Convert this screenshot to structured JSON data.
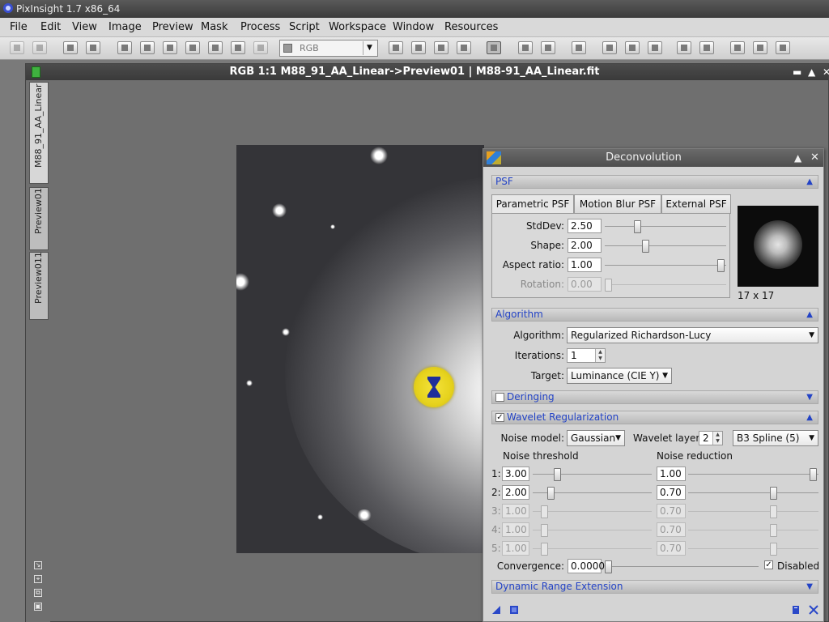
{
  "app": {
    "title": "PixInsight 1.7 x86_64"
  },
  "menu": [
    "File",
    "Edit",
    "View",
    "Image",
    "Preview",
    "Mask",
    "Process",
    "Script",
    "Workspace",
    "Window",
    "Resources"
  ],
  "toolbar": {
    "color_mode": "RGB"
  },
  "image_window": {
    "title": "RGB 1:1 M88_91_AA_Linear->Preview01 | M88-91_AA_Linear.fit",
    "tabs": [
      "M88_91_AA_Linear",
      "Preview01",
      "Preview011"
    ]
  },
  "deconvolution": {
    "title": "Deconvolution",
    "psf": {
      "section": "PSF",
      "tabs": [
        "Parametric PSF",
        "Motion Blur PSF",
        "External PSF"
      ],
      "stddev_label": "StdDev:",
      "stddev": "2.50",
      "shape_label": "Shape:",
      "shape": "2.00",
      "aspect_label": "Aspect ratio:",
      "aspect": "1.00",
      "rotation_label": "Rotation:",
      "rotation": "0.00",
      "size": "17 x 17"
    },
    "algorithm": {
      "section": "Algorithm",
      "algorithm_label": "Algorithm:",
      "algorithm": "Regularized Richardson-Lucy",
      "iterations_label": "Iterations:",
      "iterations": "1",
      "target_label": "Target:",
      "target": "Luminance (CIE Y)"
    },
    "deringing": {
      "section": "Deringing",
      "checked": false
    },
    "wavelet": {
      "section": "Wavelet Regularization",
      "checked": true,
      "noise_model_label": "Noise model:",
      "noise_model": "Gaussian",
      "layers_label": "Wavelet layers:",
      "layers": "2",
      "scaling": "B3 Spline (5)",
      "threshold_header": "Noise threshold",
      "reduction_header": "Noise reduction",
      "rows": [
        {
          "n": "1:",
          "threshold": "3.00",
          "reduction": "1.00",
          "enabled": true
        },
        {
          "n": "2:",
          "threshold": "2.00",
          "reduction": "0.70",
          "enabled": true
        },
        {
          "n": "3:",
          "threshold": "1.00",
          "reduction": "0.70",
          "enabled": false
        },
        {
          "n": "4:",
          "threshold": "1.00",
          "reduction": "0.70",
          "enabled": false
        },
        {
          "n": "5:",
          "threshold": "1.00",
          "reduction": "0.70",
          "enabled": false
        }
      ],
      "convergence_label": "Convergence:",
      "convergence": "0.0000",
      "disabled_label": "Disabled",
      "disabled_checked": true
    },
    "dynamic_range": {
      "section": "Dynamic Range Extension"
    }
  }
}
